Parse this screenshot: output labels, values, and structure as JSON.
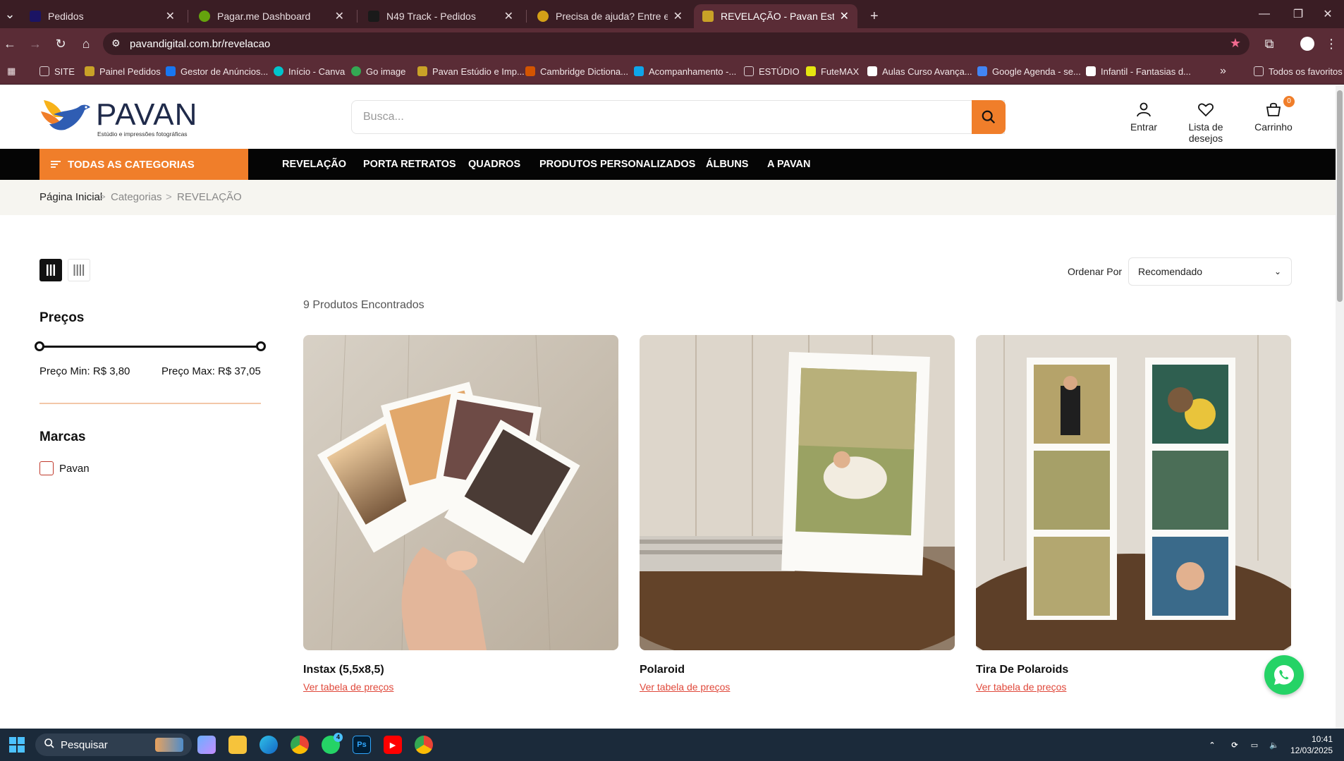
{
  "browser": {
    "tabs": [
      {
        "title": "Pedidos",
        "color": "#1b1464"
      },
      {
        "title": "Pagar.me Dashboard",
        "color": "#65a30d"
      },
      {
        "title": "N49 Track - Pedidos",
        "color": "#1a1a1a"
      },
      {
        "title": "Precisa de ajuda? Entre em cont",
        "color": "#d4a017"
      },
      {
        "title": "REVELAÇÃO - Pavan Estúdio e I",
        "color": "#c9a227"
      }
    ],
    "new_tab": "+",
    "url": "pavandigital.com.br/revelacao",
    "bookmarks": [
      {
        "label": "SITE",
        "color": "#9aa0a6"
      },
      {
        "label": "Painel Pedidos",
        "color": "#c9a227"
      },
      {
        "label": "Gestor de Anúncios...",
        "color": "#1877f2"
      },
      {
        "label": "Início - Canva",
        "color": "#00c4cc"
      },
      {
        "label": "Go image",
        "color": "#34a853"
      },
      {
        "label": "Pavan Estúdio e Imp...",
        "color": "#c9a227"
      },
      {
        "label": "Cambridge Dictiona...",
        "color": "#d35400"
      },
      {
        "label": "Acompanhamento -...",
        "color": "#0ea5e9"
      },
      {
        "label": "ESTÚDIO",
        "color": "#9aa0a6"
      },
      {
        "label": "FuteMAX",
        "color": "#e5e510"
      },
      {
        "label": "Aulas Curso Avança...",
        "color": "#ffffff"
      },
      {
        "label": "Google Agenda - se...",
        "color": "#4285f4"
      },
      {
        "label": "Infantil - Fantasias d...",
        "color": "#ffffff"
      }
    ],
    "bookmarks_more": "»",
    "all_bookmarks": "Todos os favoritos"
  },
  "site": {
    "logo": {
      "name": "PAVAN",
      "tagline": "Estúdio e impressões fotográficas"
    },
    "search_placeholder": "Busca...",
    "header_actions": {
      "login": "Entrar",
      "wishlist": "Lista de desejos",
      "cart": "Carrinho",
      "cart_count": "0"
    },
    "all_categories": "TODAS AS CATEGORIAS",
    "nav": [
      "REVELAÇÃO",
      "PORTA RETRATOS",
      "QUADROS",
      "PRODUTOS PERSONALIZADOS",
      "ÁLBUNS",
      "A PAVAN"
    ],
    "breadcrumb": [
      "Página Inicial",
      "Categorias",
      "REVELAÇÃO"
    ],
    "breadcrumb_sep": ">",
    "sort": {
      "label": "Ordenar Por",
      "value": "Recomendado"
    },
    "filters": {
      "prices_title": "Preços",
      "price_min": "Preço Min: R$ 3,80",
      "price_max": "Preço Max: R$ 37,05",
      "brands_title": "Marcas",
      "brands": [
        "Pavan"
      ]
    },
    "found": "9 Produtos Encontrados",
    "products": [
      {
        "name": "Instax (5,5x8,5)",
        "link": "Ver tabela de preços"
      },
      {
        "name": "Polaroid",
        "link": "Ver tabela de preços"
      },
      {
        "name": "Tira De Polaroids",
        "link": "Ver tabela de preços"
      }
    ],
    "accent": "#f07e2a"
  },
  "taskbar": {
    "search": "Pesquisar",
    "time": "10:41",
    "date": "12/03/2025",
    "whatsapp_badge": "4",
    "ps_label": "Ps"
  }
}
